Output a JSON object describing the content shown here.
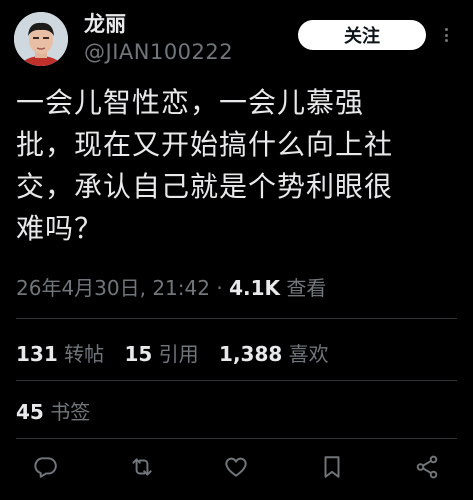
{
  "user": {
    "display_name": "龙丽",
    "handle": "@JIAN100222",
    "avatar": "avatar-photo"
  },
  "follow_label": "关注",
  "tweet": {
    "text_lines": [
      "一会儿智性恋，一会儿慕强",
      "批，现在又开始搞什么向上社",
      "交，承认自己就是个势利眼很",
      "难吗？"
    ]
  },
  "meta": {
    "timestamp": "26年4月30日, 21:42",
    "separator": " · ",
    "views_count": "4.1K",
    "views_label": "查看"
  },
  "stats": {
    "retweets_count": "131",
    "retweets_label": "转帖",
    "quotes_count": "15",
    "quotes_label": "引用",
    "likes_count": "1,388",
    "likes_label": "喜欢",
    "bookmarks_count": "45",
    "bookmarks_label": "书签"
  },
  "actions": [
    "reply-icon",
    "retweet-icon",
    "like-icon",
    "bookmark-icon",
    "share-icon"
  ],
  "colors": {
    "background": "#000000",
    "primary_text": "#e7e9ea",
    "secondary_text": "#71767b",
    "divider": "#2f3336",
    "follow_button_bg": "#ffffff"
  }
}
